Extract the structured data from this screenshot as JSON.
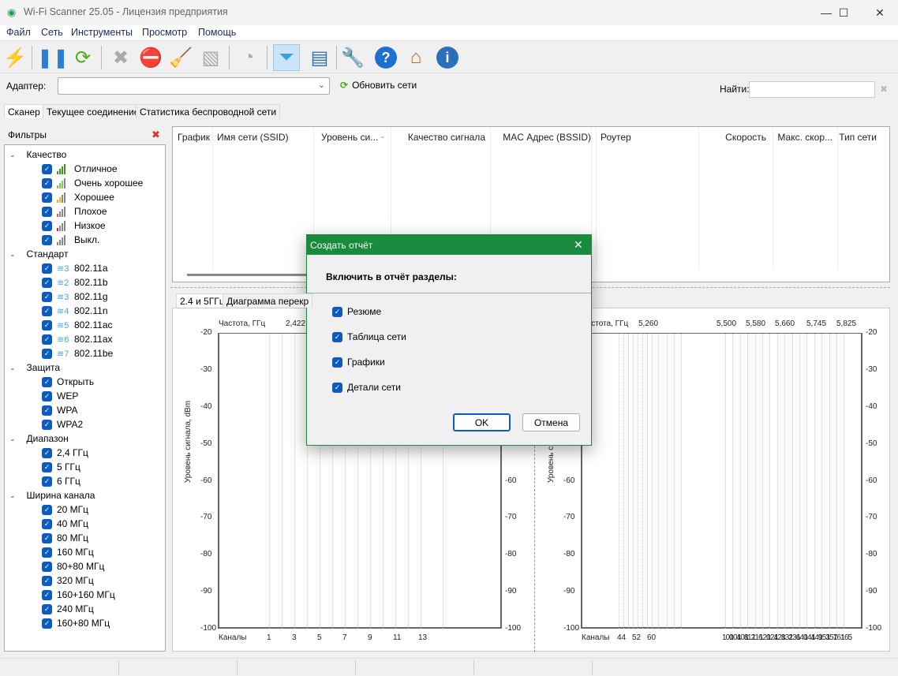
{
  "window": {
    "title": "Wi-Fi Scanner 25.05 - Лицензия предприятия",
    "minimize": "—",
    "maximize": "☐",
    "close": "✕"
  },
  "menu": [
    "Файл",
    "Сеть",
    "Инструменты",
    "Просмотр",
    "Помощь"
  ],
  "toolbar": [
    {
      "icon": "lightning-icon",
      "glyph": "⚡",
      "color": "#aaaaaa"
    },
    {
      "icon": "pause-icon",
      "glyph": "❚❚",
      "color": "#2a7fd4"
    },
    {
      "icon": "refresh-icon",
      "glyph": "⟳",
      "color": "#4caf1a"
    },
    {
      "icon": "delete-icon",
      "glyph": "✖",
      "color": "#aaaaaa"
    },
    {
      "icon": "signal-block-icon",
      "glyph": "⛔",
      "color": "#dd3333"
    },
    {
      "icon": "broom-icon",
      "glyph": "🧹",
      "color": "#aaaaaa"
    },
    {
      "icon": "export-icon",
      "glyph": "▧",
      "color": "#aaaaaa"
    },
    {
      "icon": "rss-icon",
      "glyph": "◔",
      "color": "#aaaaaa"
    },
    {
      "icon": "filter-icon",
      "glyph": "⏷",
      "color": "#3aa0d8"
    },
    {
      "icon": "report-icon",
      "glyph": "▤",
      "color": "#2a6fb8"
    },
    {
      "icon": "wrench-icon",
      "glyph": "🔧",
      "color": "#e89420"
    },
    {
      "icon": "help-icon",
      "glyph": "?",
      "color": "#1e6fd0"
    },
    {
      "icon": "home-icon",
      "glyph": "⌂",
      "color": "#c07020"
    },
    {
      "icon": "info-icon",
      "glyph": "i",
      "color": "#2a6fb8"
    }
  ],
  "adapter": {
    "label": "Адаптер:",
    "value": "",
    "refresh_label": "Обновить сети"
  },
  "search": {
    "label": "Найти:",
    "value": "",
    "clear": "✖"
  },
  "tabs": [
    "Сканер",
    "Текущее соединение",
    "Статистика беспроводной сети"
  ],
  "filters": {
    "title": "Фильтры",
    "clear": "✖",
    "groups": [
      {
        "label": "Качество",
        "items": [
          {
            "label": "Отличное",
            "bars": 4,
            "color": "#3a9a1a"
          },
          {
            "label": "Очень хорошее",
            "bars": 3,
            "color": "#7ad04a"
          },
          {
            "label": "Хорошее",
            "bars": 2,
            "color": "#e0c000"
          },
          {
            "label": "Плохое",
            "bars": 1,
            "color": "#e06030"
          },
          {
            "label": "Низкое",
            "bars": 1,
            "color": "#d02020"
          },
          {
            "label": "Выкл.",
            "bars": 0,
            "color": "#888888"
          }
        ]
      },
      {
        "label": "Стандарт",
        "items": [
          {
            "label": "802.11a",
            "badge": "3"
          },
          {
            "label": "802.11b",
            "badge": "2"
          },
          {
            "label": "802.11g",
            "badge": "3"
          },
          {
            "label": "802.11n",
            "badge": "4"
          },
          {
            "label": "802.11ac",
            "badge": "5"
          },
          {
            "label": "802.11ax",
            "badge": "6"
          },
          {
            "label": "802.11be",
            "badge": "7"
          }
        ]
      },
      {
        "label": "Защита",
        "items": [
          {
            "label": "Открыть"
          },
          {
            "label": "WEP"
          },
          {
            "label": "WPA"
          },
          {
            "label": "WPA2"
          }
        ]
      },
      {
        "label": "Диапазон",
        "items": [
          {
            "label": "2,4 ГГц"
          },
          {
            "label": "5 ГГц"
          },
          {
            "label": "6 ГГц"
          }
        ]
      },
      {
        "label": "Ширина канала",
        "items": [
          {
            "label": "20 МГц"
          },
          {
            "label": "40 МГц"
          },
          {
            "label": "80 МГц"
          },
          {
            "label": "160 МГц"
          },
          {
            "label": "80+80 МГц"
          },
          {
            "label": "320 МГц"
          },
          {
            "label": "160+160 МГц"
          },
          {
            "label": "240 МГц"
          },
          {
            "label": "160+80 МГц"
          }
        ]
      }
    ]
  },
  "table": {
    "columns": [
      "График",
      "Имя сети (SSID)",
      "Уровень си...",
      "Качество сигнала",
      "MAC Адрес (BSSID)",
      "Роутер",
      "Скорость",
      "Макс. скор...",
      "Тип сети"
    ],
    "rows": []
  },
  "chart_tabs": [
    "2.4 и 5ГГц",
    "Диаграмма перекр"
  ],
  "charts": {
    "ylabel": "Уровень сигнала, dBm",
    "yticks": [
      -20,
      -30,
      -40,
      -50,
      -60,
      -70,
      -80,
      -90,
      -100
    ],
    "freq_label": "Частота, ГГц",
    "channel_label": "Каналы",
    "left": {
      "channels": [
        "1",
        "3",
        "5",
        "7",
        "9",
        "11",
        "13"
      ],
      "freqs": [
        "2,422"
      ]
    },
    "right": {
      "channels_low": [
        "44",
        "52",
        "60"
      ],
      "channels_high": [
        "100",
        "104",
        "108",
        "112",
        "116",
        "120",
        "124",
        "128",
        "132",
        "136",
        "140",
        "144",
        "149",
        "153",
        "157",
        "161",
        "165"
      ],
      "freqs": [
        "5,260",
        "5,500",
        "5,580",
        "5,660",
        "5,745",
        "5,825"
      ]
    }
  },
  "dialog": {
    "title": "Создать отчёт",
    "close": "✕",
    "heading": "Включить в отчёт разделы:",
    "options": [
      {
        "label": "Резюме",
        "checked": true
      },
      {
        "label": "Таблица сети",
        "checked": true
      },
      {
        "label": "Графики",
        "checked": true
      },
      {
        "label": "Детали сети",
        "checked": true
      }
    ],
    "ok": "OK",
    "cancel": "Отмена"
  }
}
